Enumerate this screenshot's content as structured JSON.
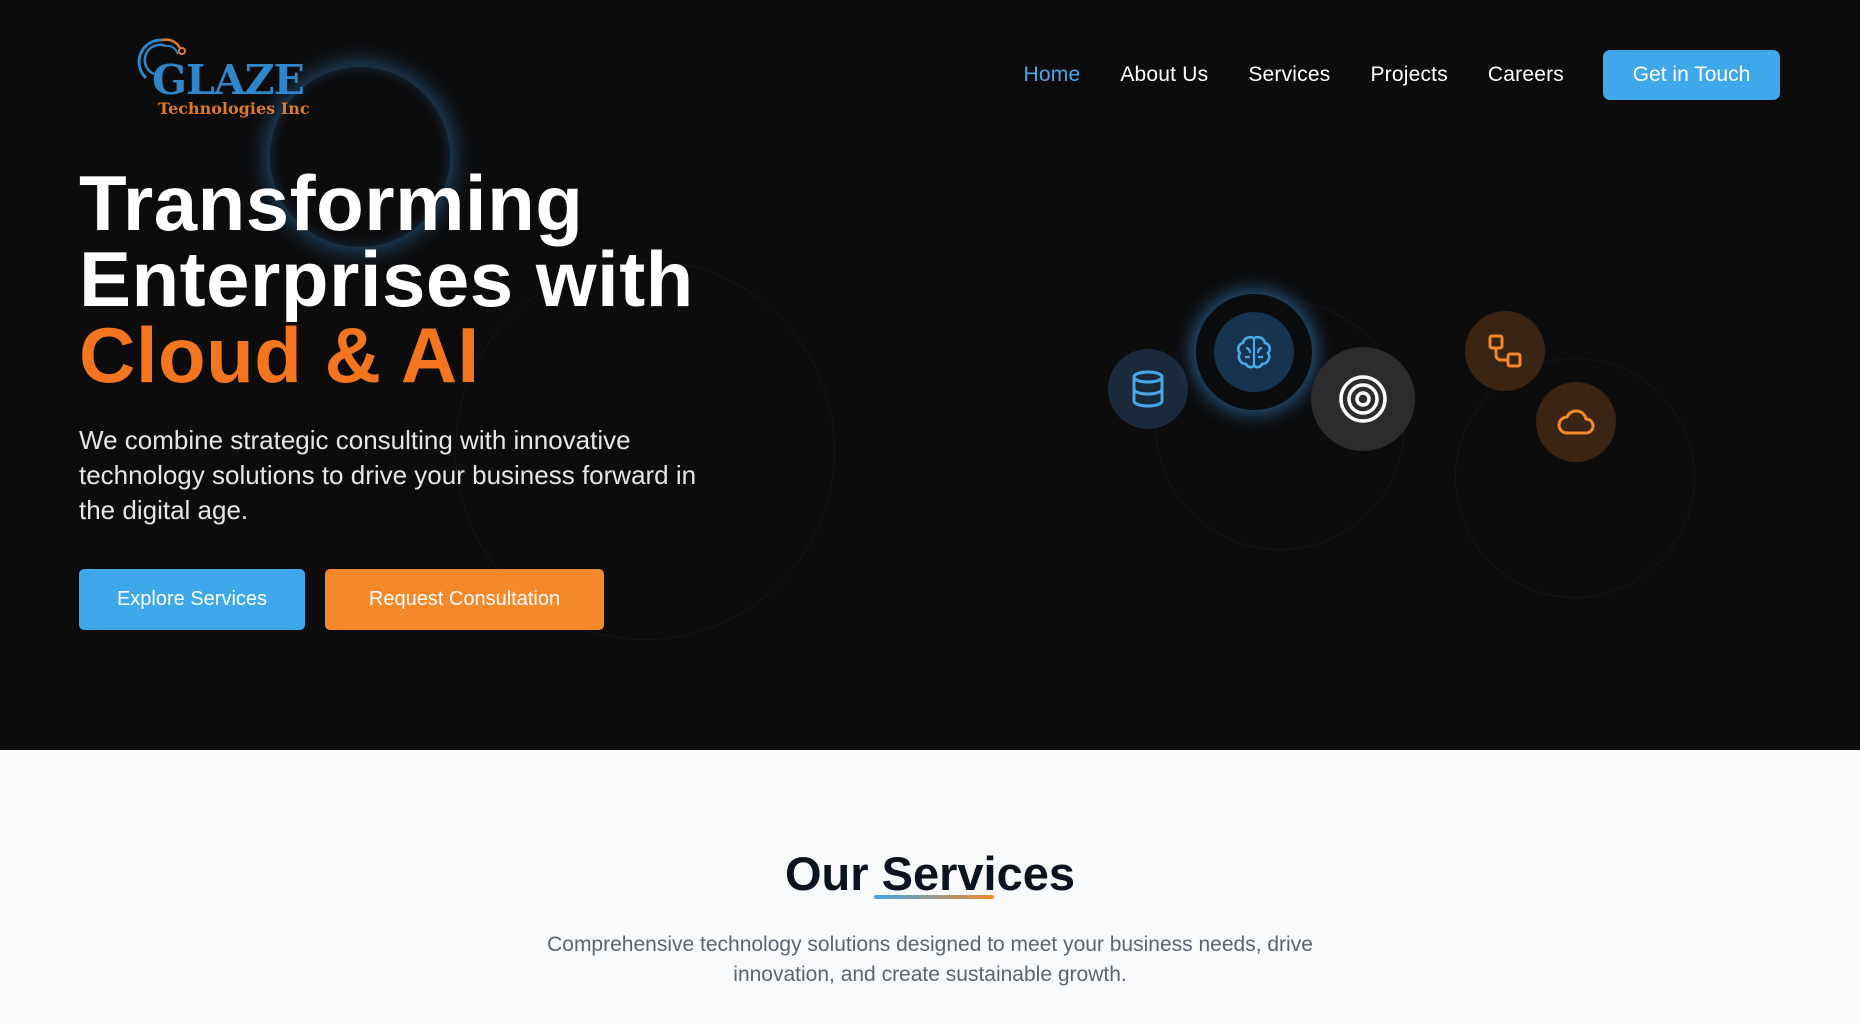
{
  "logo": {
    "brand": "GLAZE",
    "sub": "Technologies Inc"
  },
  "nav": {
    "items": [
      {
        "label": "Home",
        "active": true
      },
      {
        "label": "About Us"
      },
      {
        "label": "Services"
      },
      {
        "label": "Projects"
      },
      {
        "label": "Careers"
      }
    ],
    "cta": "Get in Touch"
  },
  "hero": {
    "line1": "Transforming",
    "line2": "Enterprises with",
    "line3": "Cloud & AI",
    "lead": "We combine strategic consulting with innovative technology solutions to drive your business forward in the digital age.",
    "primary_button": "Explore Services",
    "secondary_button": "Request Consultation",
    "icons": [
      "database-icon",
      "brain-icon",
      "target-icon",
      "workflow-icon",
      "cloud-icon"
    ]
  },
  "services": {
    "title": "Our Services",
    "description": "Comprehensive technology solutions designed to meet your business needs, drive innovation, and create sustainable growth."
  },
  "colors": {
    "accent_blue": "#3ea8ea",
    "accent_orange": "#f5751f",
    "hero_bg": "#0c0c0d"
  }
}
